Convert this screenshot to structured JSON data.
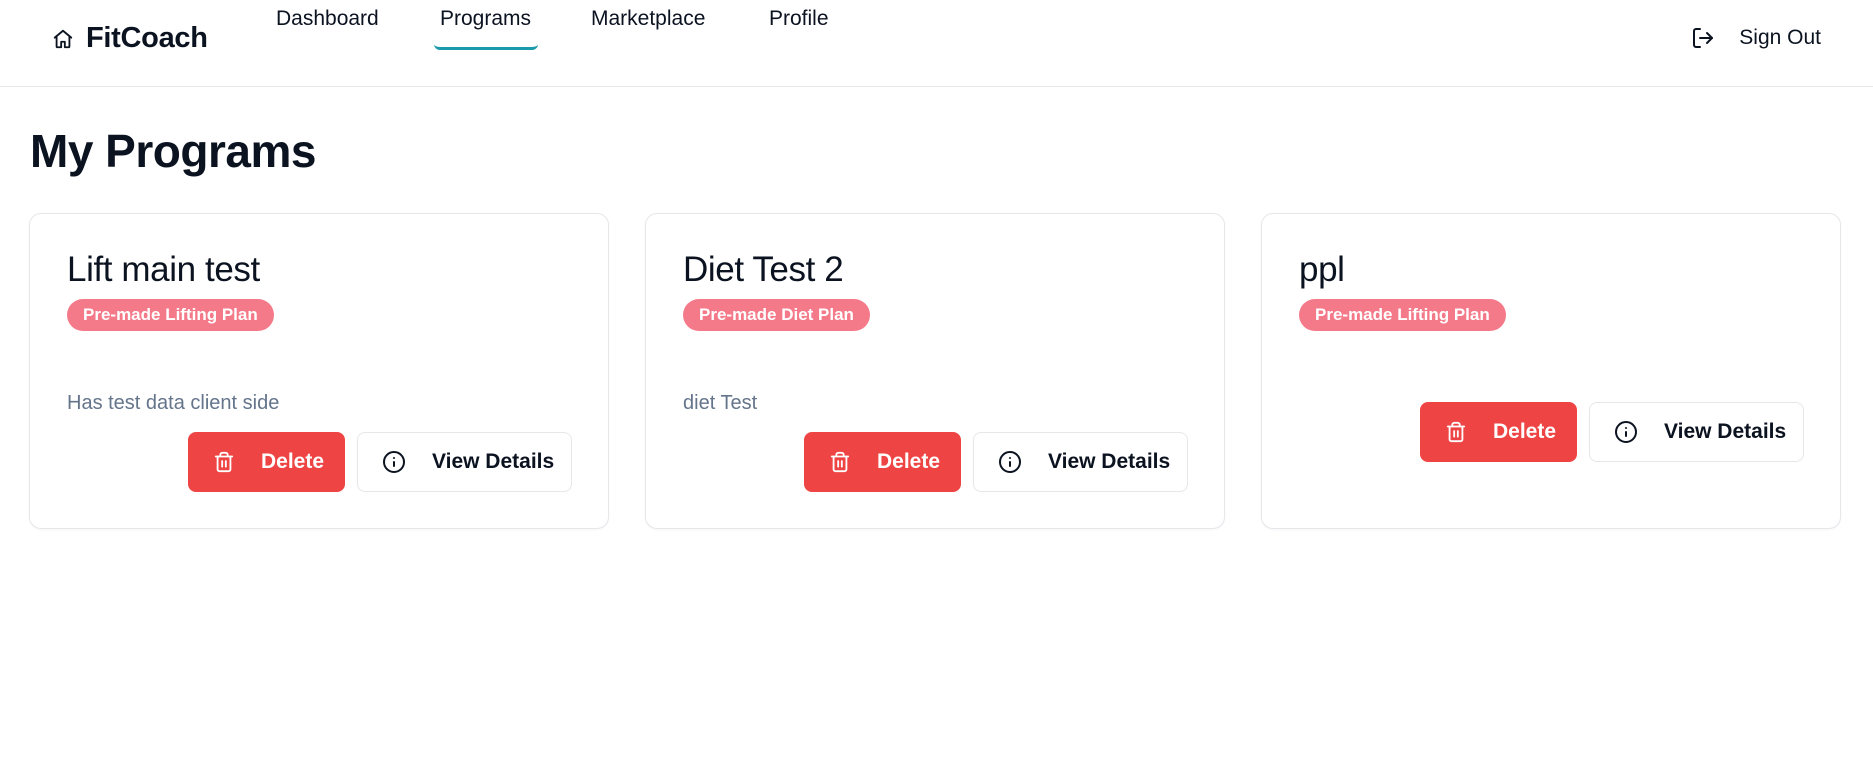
{
  "app": {
    "name": "FitCoach",
    "brand_icon": "home-icon"
  },
  "nav": {
    "items": [
      {
        "label": "Dashboard",
        "active": false
      },
      {
        "label": "Programs",
        "active": true
      },
      {
        "label": "Marketplace",
        "active": false
      },
      {
        "label": "Profile",
        "active": false
      }
    ],
    "active_underline_color": "#1a9aaa"
  },
  "signout": {
    "label": "Sign Out",
    "icon": "log-out-icon"
  },
  "page": {
    "title": "My Programs"
  },
  "colors": {
    "badge": "#f47a8a",
    "delete_button": "#ef4444",
    "description_text": "#64748b"
  },
  "programs": [
    {
      "title": "Lift main test",
      "badge": "Pre-made Lifting Plan",
      "description": "Has test data client side",
      "delete_label": "Delete",
      "view_label": "View Details"
    },
    {
      "title": "Diet Test 2",
      "badge": "Pre-made Diet Plan",
      "description": "diet Test",
      "delete_label": "Delete",
      "view_label": "View Details"
    },
    {
      "title": "ppl",
      "badge": "Pre-made Lifting Plan",
      "description": "",
      "delete_label": "Delete",
      "view_label": "View Details"
    }
  ]
}
